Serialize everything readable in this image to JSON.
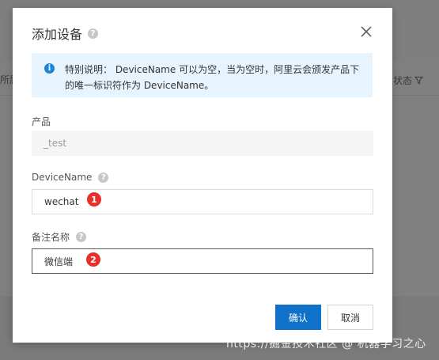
{
  "background": {
    "left_text": "所属",
    "right_text": "状态"
  },
  "modal": {
    "title": "添加设备",
    "notice": "特别说明： DeviceName 可以为空，当为空时，阿里云会颁发产品下的唯一标识符作为 DeviceName。",
    "product_label": "产品",
    "product_value": "_test",
    "devname_label": "DeviceName",
    "devname_value": "wechat",
    "remark_label": "备注名称",
    "remark_value": "微信端",
    "badge_1": "1",
    "badge_2": "2",
    "ok_label": "确认",
    "cancel_label": "取消"
  },
  "watermark": "https://掘金技术社区 @ 机器学习之心",
  "colors": {
    "primary": "#0f71c9",
    "notice_bg": "#e7f4fd",
    "info_icon": "#1a84d8",
    "badge": "#e8302b"
  },
  "icons": {
    "help": "question-circle-icon",
    "close": "close-icon",
    "info": "info-circle-icon",
    "filter": "filter-icon"
  }
}
